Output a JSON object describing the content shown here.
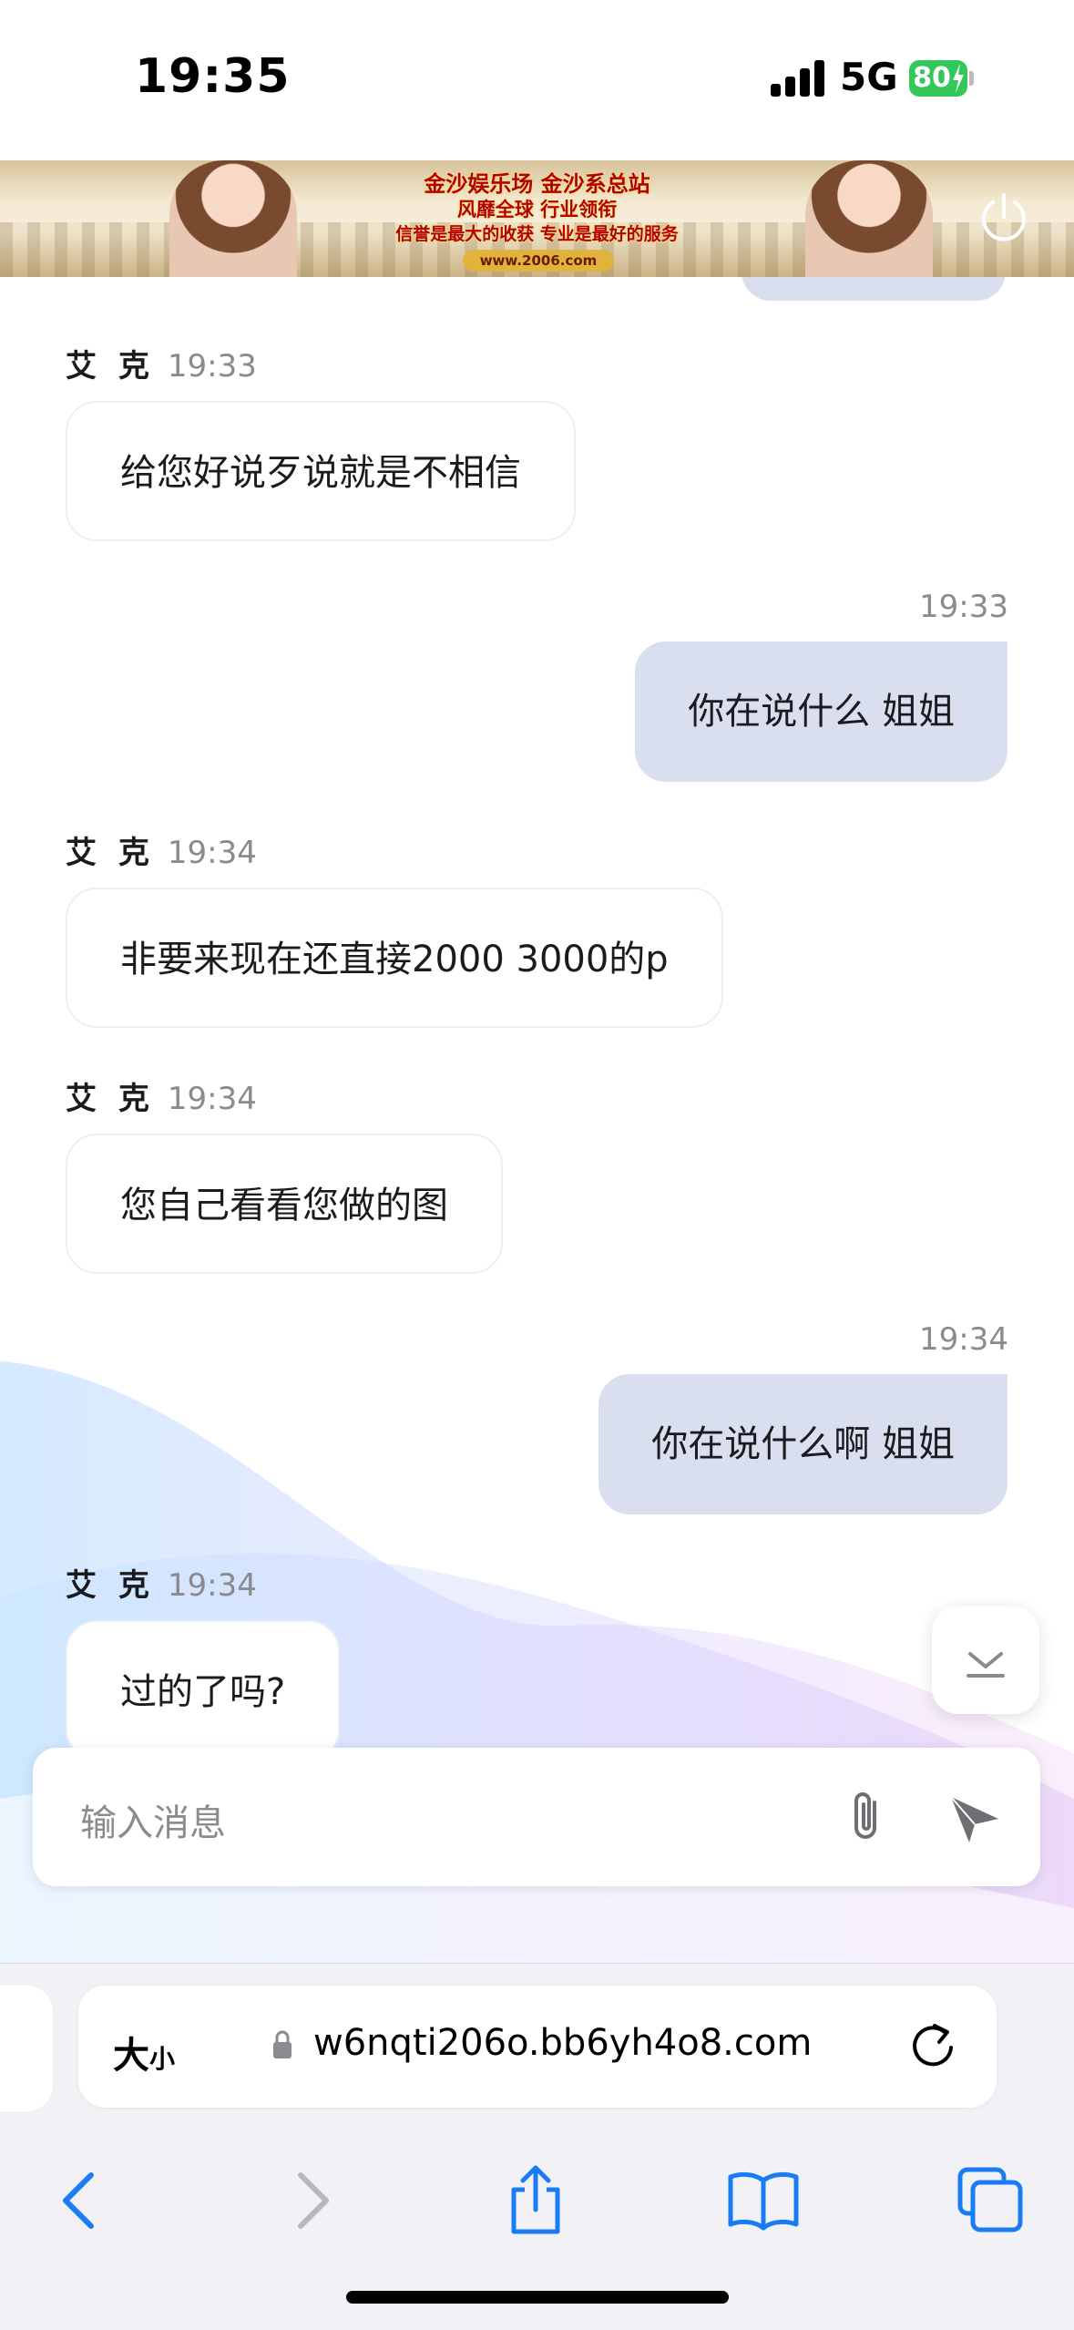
{
  "status_bar": {
    "time": "19:35",
    "network": "5G",
    "battery": "80"
  },
  "banner": {
    "line1": "金沙娱乐场 金沙系总站",
    "line2": "风靡全球 行业领衔",
    "line3": "信誉是最大的收获 专业是最好的服务",
    "url": "www.2006.com"
  },
  "messages": [
    {
      "direction": "in",
      "sender": "艾 克",
      "time": "19:33",
      "text": "给您好说歹说就是不相信"
    },
    {
      "direction": "out",
      "time": "19:33",
      "text": "你在说什么 姐姐"
    },
    {
      "direction": "in",
      "sender": "艾 克",
      "time": "19:34",
      "text": "非要来现在还直接2000 3000的p"
    },
    {
      "direction": "in",
      "sender": "艾 克",
      "time": "19:34",
      "text": "您自己看看您做的图"
    },
    {
      "direction": "out",
      "time": "19:34",
      "text": "你在说什么啊 姐姐"
    },
    {
      "direction": "in",
      "sender": "艾 克",
      "time": "19:34",
      "text": "过的了吗?"
    }
  ],
  "composer": {
    "placeholder": "输入消息"
  },
  "browser": {
    "text_size_big": "大",
    "text_size_small": "小",
    "url": "w6nqti206o.bb6yh4o8.com"
  },
  "colors": {
    "outgoing_bubble": "#dadff0",
    "incoming_bubble": "#ffffff",
    "battery": "#34c759",
    "safari_accent": "#1a7cf5"
  },
  "icons": [
    "signal-icon",
    "battery-icon",
    "power-icon",
    "chevron-down-icon",
    "paperclip-icon",
    "send-icon",
    "lock-icon",
    "reload-icon",
    "back-icon",
    "forward-icon",
    "share-icon",
    "bookmarks-icon",
    "tabs-icon"
  ]
}
